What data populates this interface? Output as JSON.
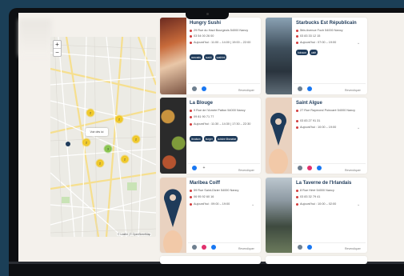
{
  "map": {
    "zoom_in": "+",
    "zoom_out": "−",
    "popup_label": "Voir dès ici",
    "attribution": "© Leaflet | © OpenStreetMap",
    "markers": [
      {
        "label": "2",
        "color": "#f1c40f"
      },
      {
        "label": "2",
        "color": "#f1c40f"
      },
      {
        "label": "2",
        "color": "#f1c40f"
      },
      {
        "label": "3",
        "color": "#7bbf3a"
      },
      {
        "label": "2",
        "color": "#f1c40f"
      },
      {
        "label": "2",
        "color": "#f1c40f"
      },
      {
        "label": "2",
        "color": "#f1c40f"
      }
    ]
  },
  "cards": [
    {
      "title": "Hungry Sushi",
      "address": "29 Rue du Haut Bourgeois 54000 Nancy",
      "phone": "03 54 00 26 00",
      "hours": "Aujourd'hui : 11:00 – 14:00 | 19:00 – 22:00",
      "tags": [
        "avocado",
        "sushi",
        "sashimi"
      ],
      "claim": "Revendiquer"
    },
    {
      "title": "Starbucks Est Républicain",
      "address": "5bis Avenue Foch 54000 Nancy",
      "phone": "03 83 33 12 15",
      "hours": "Aujourd'hui : 07:00 – 19:00",
      "tags": [
        "boisson",
        "café"
      ],
      "claim": "Revendiquer"
    },
    {
      "title": "La Blouge",
      "address": "9 Rue de l'Armée Patton 54000 Nancy",
      "phone": "09 81 90 71 77",
      "hours": "Aujourd'hui : 11:30 – 14:30 | 17:30 – 22:30",
      "tags": [
        "livraison",
        "burger",
        "cuisine libanaise"
      ],
      "claim": "Revendiquer"
    },
    {
      "title": "Saint Algue",
      "address": "27 Rue Raymond Poincaré 54000 Nancy",
      "phone": "03 83 27 91 31",
      "hours": "Aujourd'hui : 10:00 – 19:00",
      "tags": [],
      "claim": "Revendiquer"
    },
    {
      "title": "Maribea Coiff",
      "address": "59 Rue Saint-Dizier 54000 Nancy",
      "phone": "06 95 92 60 16",
      "hours": "Aujourd'hui : 09:00 – 19:00",
      "tags": [],
      "claim": "Revendiquer"
    },
    {
      "title": "La Taverne de l'Irlandais",
      "address": "8 Rue Héré 54000 Nancy",
      "phone": "03 83 32 79 41",
      "hours": "Aujourd'hui : 10:00 – 02:00",
      "tags": [],
      "claim": "Revendiquer"
    }
  ],
  "colors": {
    "brand": "#1f3b5a",
    "accent": "#d23b3b",
    "facebook": "#1877f2",
    "instagram": "#e1306c",
    "bg": "#f4f1ec"
  },
  "icons": [
    "pin-icon",
    "phone-icon",
    "clock-icon",
    "facebook-icon",
    "instagram-icon",
    "globe-icon",
    "plus-icon",
    "chevron-down-icon"
  ]
}
